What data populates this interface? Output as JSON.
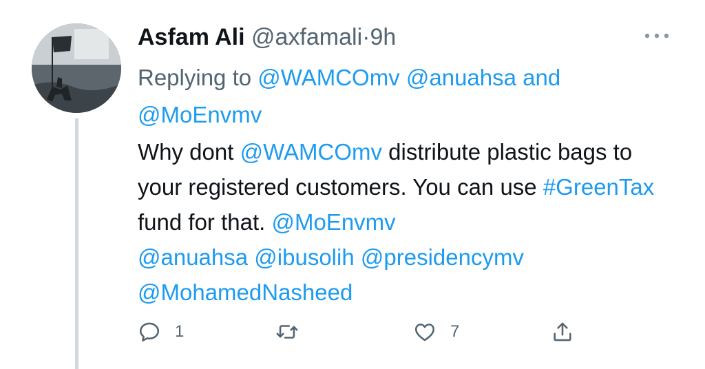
{
  "tweet": {
    "display_name": "Asfam Ali",
    "handle": "@axfamali",
    "separator": "·",
    "timestamp": "9h",
    "replying_prefix": "Replying to",
    "reply_to_1": "@WAMCOmv",
    "reply_to_2": "@anuahsa",
    "reply_to_conj": "and",
    "reply_to_3": "@MoEnvmv",
    "body": {
      "t1": "Why dont ",
      "m1": "@WAMCOmv",
      "t2": " distribute plastic bags to your registered customers. You can use ",
      "h1": "#GreenTax",
      "t3": " fund for that. ",
      "m2": "@MoEnvmv",
      "m3": "@anuahsa",
      "m4": "@ibusolih",
      "m5": "@presidencymv",
      "m6": "@MohamedNasheed"
    },
    "actions": {
      "reply_count": "1",
      "like_count": "7"
    },
    "icons": [
      "more-icon",
      "reply-icon",
      "retweet-icon",
      "like-icon",
      "share-icon"
    ],
    "colors": {
      "link": "#1d9bf0",
      "secondary": "#536471",
      "text": "#0f1419"
    }
  }
}
